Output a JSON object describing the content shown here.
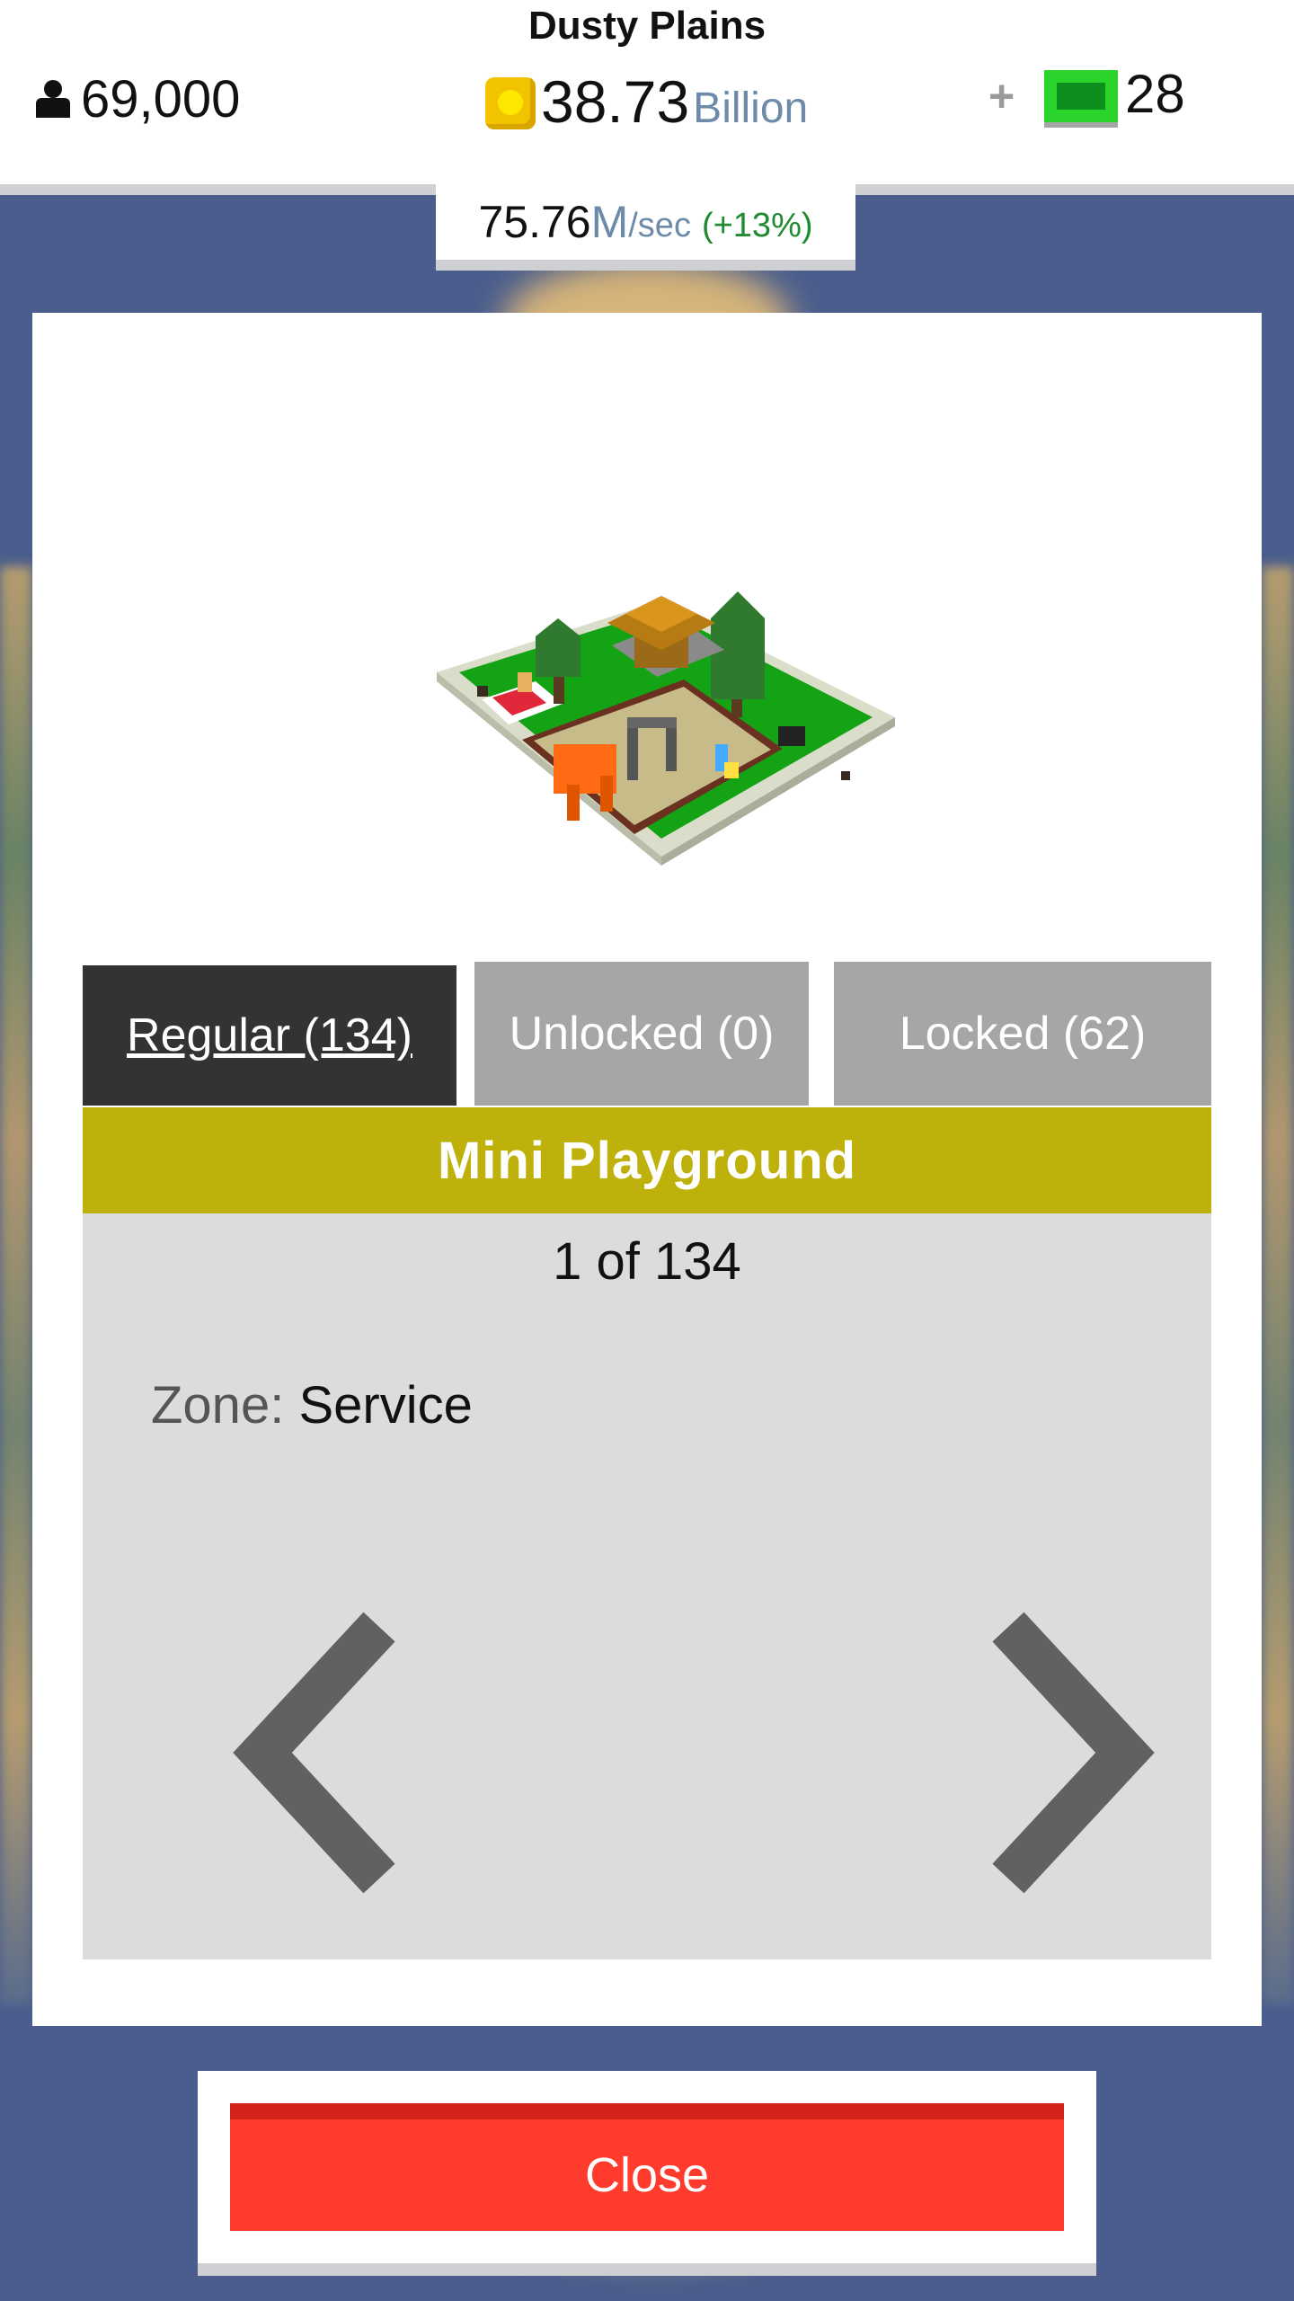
{
  "hud": {
    "city_name": "Dusty Plains",
    "population": "69,000",
    "coins_value": "38.73",
    "coins_unit": "Billion",
    "plus": "+",
    "cash_value": "28",
    "rate_value": "75.76",
    "rate_unit_m": "M",
    "rate_unit": "/sec",
    "rate_bonus": "(+13%)"
  },
  "tabs": [
    {
      "label": "Regular (134)",
      "active": true
    },
    {
      "label": "Unlocked (0)",
      "active": false
    },
    {
      "label": "Locked (62)",
      "active": false
    }
  ],
  "building": {
    "name": "Mini Playground",
    "counter": "1 of 134",
    "zone_label": "Zone:",
    "zone_value": "Service"
  },
  "close_label": "Close",
  "colors": {
    "background": "#4a5d8c",
    "title_bar": "#bfb10c",
    "close_button": "#ff3b2e",
    "tab_active": "#333333",
    "tab_inactive": "#a6a6a6"
  }
}
